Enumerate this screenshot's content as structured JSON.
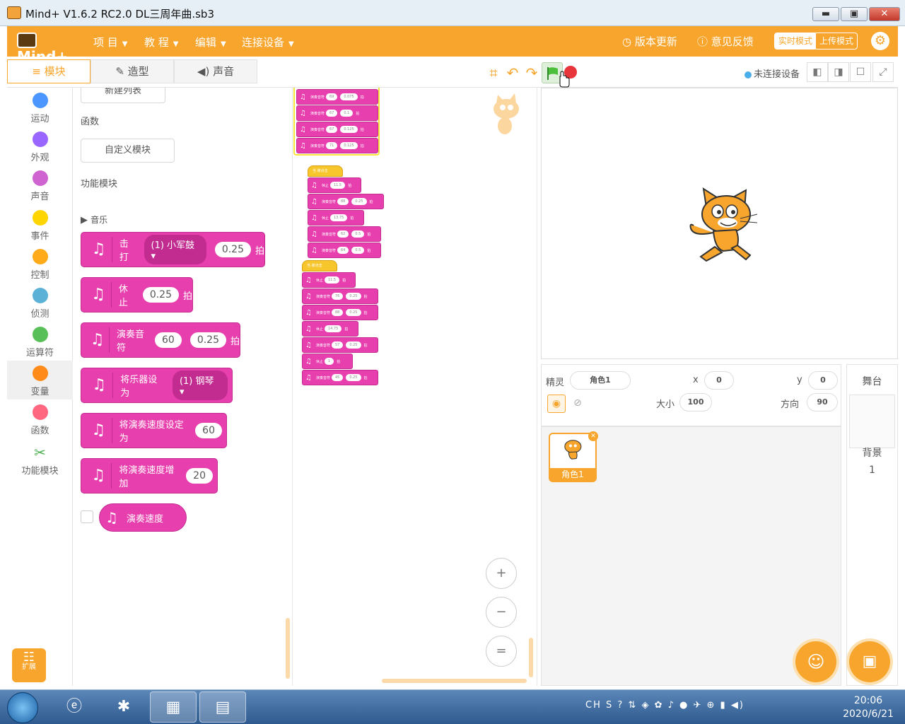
{
  "window": {
    "title": "Mind+ V1.6.2 RC2.0   DL三周年曲.sb3",
    "min": "▬",
    "max": "▣",
    "close": "✕"
  },
  "menubar": {
    "logo": "Mind+",
    "items": [
      {
        "label": "项 目"
      },
      {
        "label": "教 程"
      },
      {
        "label": "编辑"
      },
      {
        "label": "连接设备"
      }
    ],
    "update": "版本更新",
    "feedback": "意见反馈",
    "mode_realtime": "实时模式",
    "mode_upload": "上传模式"
  },
  "tabs": [
    {
      "label": "模块"
    },
    {
      "label": "造型"
    },
    {
      "label": "声音"
    }
  ],
  "connection": "未连接设备",
  "categories": [
    {
      "label": "运动",
      "color": "#4c97ff"
    },
    {
      "label": "外观",
      "color": "#9966ff"
    },
    {
      "label": "声音",
      "color": "#cf63cf"
    },
    {
      "label": "事件",
      "color": "#ffd500"
    },
    {
      "label": "控制",
      "color": "#ffab19"
    },
    {
      "label": "侦测",
      "color": "#5cb1d6"
    },
    {
      "label": "运算符",
      "color": "#59c059"
    },
    {
      "label": "变量",
      "color": "#ff8c1a"
    },
    {
      "label": "函数",
      "color": "#ff6680"
    },
    {
      "label": "功能模块",
      "color": "#4caf50"
    }
  ],
  "expand_label": "扩展",
  "palette": {
    "new_list": "新建列表",
    "functions_header": "函数",
    "custom_block": "自定义模块",
    "modules_header": "功能模块",
    "music_header": "音乐",
    "blocks": {
      "drum": {
        "text": "击打",
        "drum": "(1) 小军鼓",
        "beats": "0.25",
        "unit": "拍"
      },
      "rest": {
        "text": "休止",
        "beats": "0.25",
        "unit": "拍"
      },
      "note": {
        "text": "演奏音符",
        "note": "60",
        "beats": "0.25",
        "unit": "拍"
      },
      "instrument": {
        "text": "将乐器设为",
        "inst": "(1) 钢琴"
      },
      "set_tempo": {
        "text": "将演奏速度设定为",
        "val": "60"
      },
      "change_tempo": {
        "text": "将演奏速度增加",
        "val": "20"
      },
      "tempo": {
        "text": "演奏速度"
      }
    }
  },
  "script": {
    "top_stack": [
      [
        "演奏音符",
        "69",
        "0.075"
      ],
      [
        "演奏音符",
        "67",
        "0.1"
      ],
      [
        "演奏音符",
        "67",
        "0.125"
      ],
      [
        "演奏音符",
        "71",
        "0.125"
      ]
    ],
    "hat1": "当 被点击",
    "stack1": [
      [
        "休止",
        "11.5"
      ],
      [
        "演奏音符",
        "88",
        "0.25"
      ],
      [
        "休止",
        "13.75"
      ],
      [
        "演奏音符",
        "62",
        "0.5"
      ],
      [
        "演奏音符",
        "64",
        "0.5"
      ]
    ],
    "hat2": "当 被点击",
    "stack2": [
      [
        "休止",
        "11.5"
      ],
      [
        "演奏音符",
        "76",
        "0.25"
      ],
      [
        "演奏音符",
        "88",
        "0.25"
      ],
      [
        "休止",
        "14.75"
      ],
      [
        "演奏音符",
        "57",
        "0.25"
      ],
      [
        "休止",
        "1"
      ],
      [
        "演奏音符",
        "45",
        "0.25"
      ]
    ],
    "beat_unit": "拍",
    "zoom_in": "+",
    "zoom_out": "−",
    "zoom_reset": "="
  },
  "sprite_info": {
    "sprite_label": "精灵",
    "name": "角色1",
    "x_label": "x",
    "x": "0",
    "y_label": "y",
    "y": "0",
    "size_label": "大小",
    "size": "100",
    "dir_label": "方向",
    "dir": "90"
  },
  "sprites": [
    {
      "name": "角色1"
    }
  ],
  "stage_panel": {
    "title": "舞台",
    "backdrop_label": "背景",
    "backdrop_count": "1"
  },
  "taskbar": {
    "tray": "CH",
    "time": "20:06",
    "date": "2020/6/21"
  }
}
